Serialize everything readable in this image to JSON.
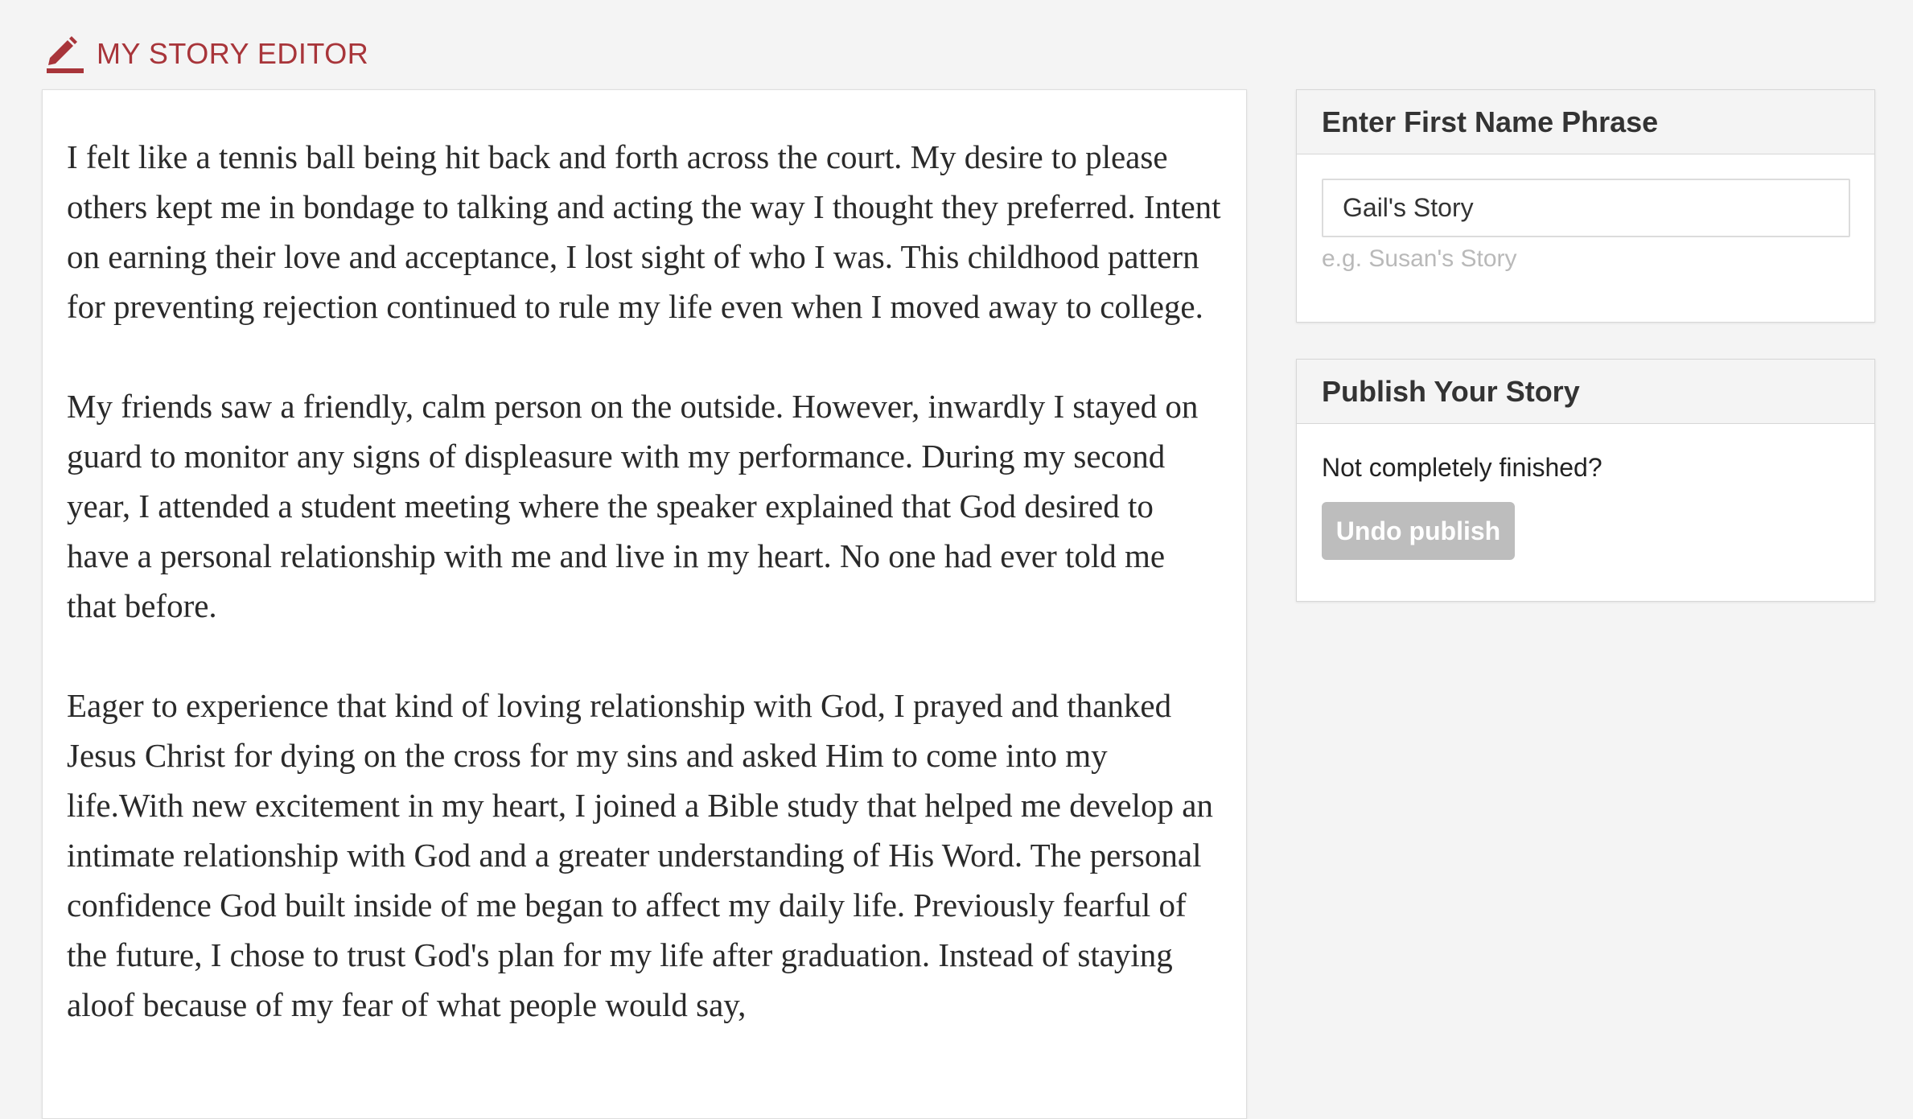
{
  "header": {
    "icon": "pencil-icon",
    "title": "MY STORY EDITOR",
    "accent_color": "#a8353a"
  },
  "editor": {
    "paragraphs": [
      "I felt like a tennis ball being hit back and forth across the court. My desire to please others kept me in bondage to talking and acting the way I thought they preferred. Intent on earning their love and acceptance, I lost sight of who I was. This childhood pattern for preventing rejection continued to rule my life even when I moved away to college.",
      "My friends saw a friendly, calm person on the outside. However, inwardly I stayed on guard to monitor any signs of displeasure with my performance. During my second year, I attended a student meeting where the speaker explained that God desired to have a personal relationship with me and live in my heart. No one had ever told me that before.",
      "Eager to experience that kind of loving relationship with God, I prayed and thanked Jesus Christ for dying on the cross for my sins and asked Him to come into my life.With new excitement in my heart, I joined a Bible study that helped me develop an intimate relationship with God and a greater understanding of His Word. The personal confidence God built inside of me began to affect my daily life. Previously fearful of the future, I chose to trust God's plan for my life after graduation. Instead of staying aloof because of my fear of what people would say,"
    ]
  },
  "name_panel": {
    "title": "Enter First Name Phrase",
    "value": "Gail's Story",
    "help": "e.g. Susan's Story"
  },
  "publish_panel": {
    "title": "Publish Your Story",
    "question": "Not completely finished?",
    "button_label": "Undo publish"
  }
}
